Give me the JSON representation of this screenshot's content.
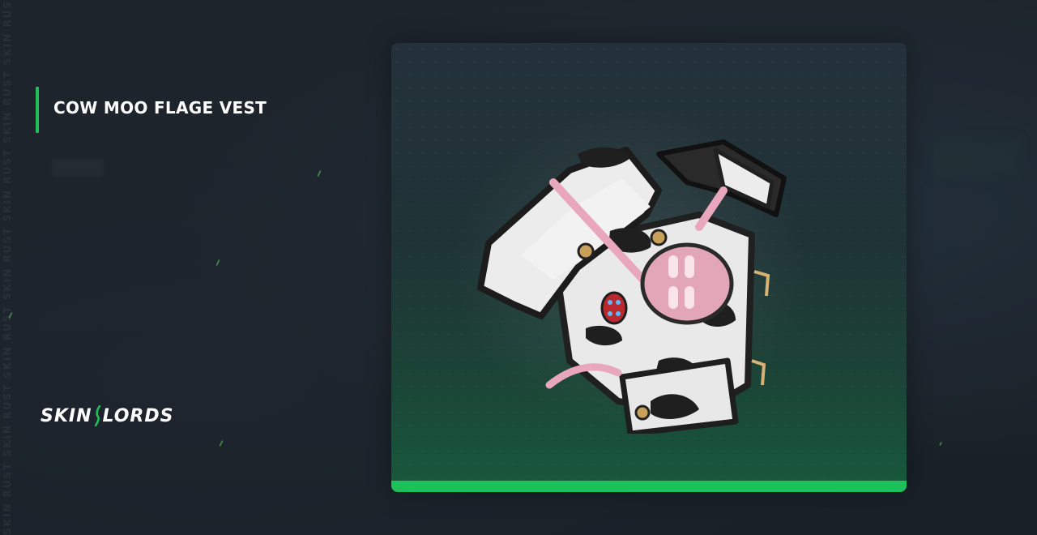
{
  "item": {
    "title": "COW MOO FLAGE VEST"
  },
  "brand": {
    "left": "SKIN",
    "right": "LORDS"
  },
  "watermark": "SKIN RUST SKIN RUST SKIN RUST SKIN RUST SKIN RUST SKIN RUST SKIN RUST SKIN RUST",
  "colors": {
    "accent": "#1fbf5b",
    "background": "#1b2129",
    "card_top": "#24313a",
    "card_bottom": "#175a3d"
  },
  "icons": {
    "brand_separator": "slash-mark-icon",
    "item_image": "cow-vest-image"
  }
}
